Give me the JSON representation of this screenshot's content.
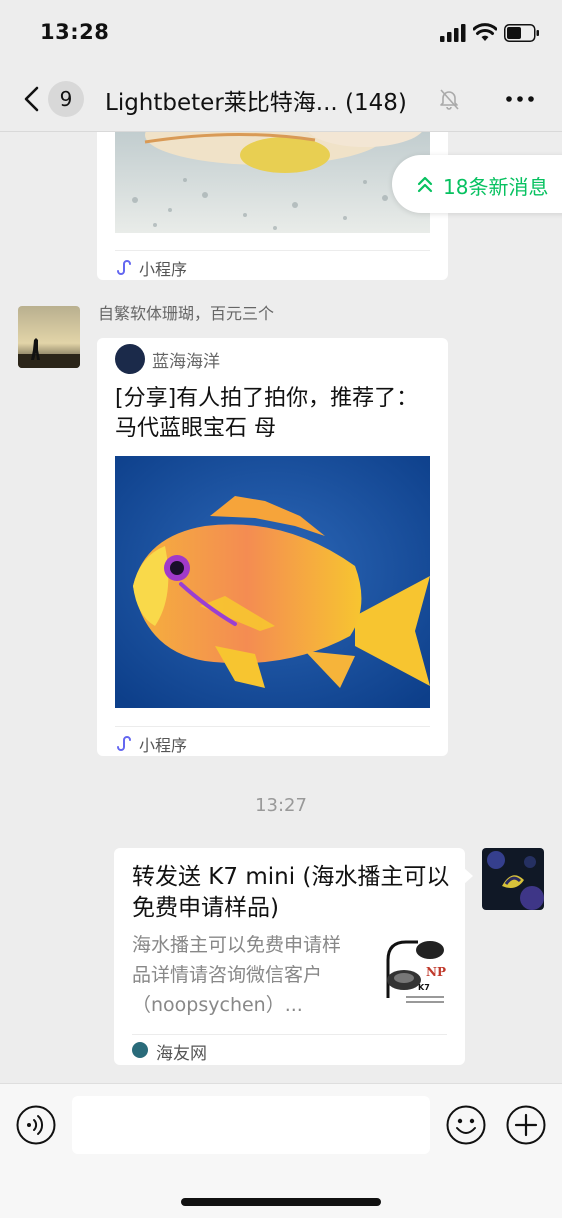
{
  "status_bar": {
    "time": "13:28",
    "icons": [
      "signal-icon",
      "wifi-icon",
      "battery-icon"
    ]
  },
  "nav": {
    "unread_count": "9",
    "title": "Lightbeter莱比特海...",
    "member_count": "(148)",
    "icons": [
      "back-icon",
      "mute-icon",
      "more-icon"
    ]
  },
  "new_messages": {
    "label": "18条新消息",
    "color": "#07c160"
  },
  "messages": [
    {
      "type": "mini-program",
      "image": "fish-photo",
      "footer_label": "小程序"
    },
    {
      "type": "mini-program",
      "sender": "自繁软体珊瑚，百元三个",
      "source_name": "蓝海海洋",
      "title": "[分享]有人拍了拍你，推荐了：马代蓝眼宝石 母",
      "image": "orange-anthias-fish-photo",
      "footer_label": "小程序"
    },
    {
      "type": "time",
      "label": "13:27"
    },
    {
      "type": "link",
      "title": "转发送 K7 mini (海水播主可以免费申请样品)",
      "description": "海水播主可以免费申请样品详情请咨询微信客户（noopsychen）...",
      "source": "海友网",
      "thumb_label": "K7"
    }
  ],
  "input_bar": {
    "placeholder": "",
    "icons": [
      "voice-icon",
      "emoji-icon",
      "plus-icon"
    ]
  },
  "colors": {
    "background": "#ededed",
    "bubble": "#ffffff",
    "accent": "#07c160"
  }
}
